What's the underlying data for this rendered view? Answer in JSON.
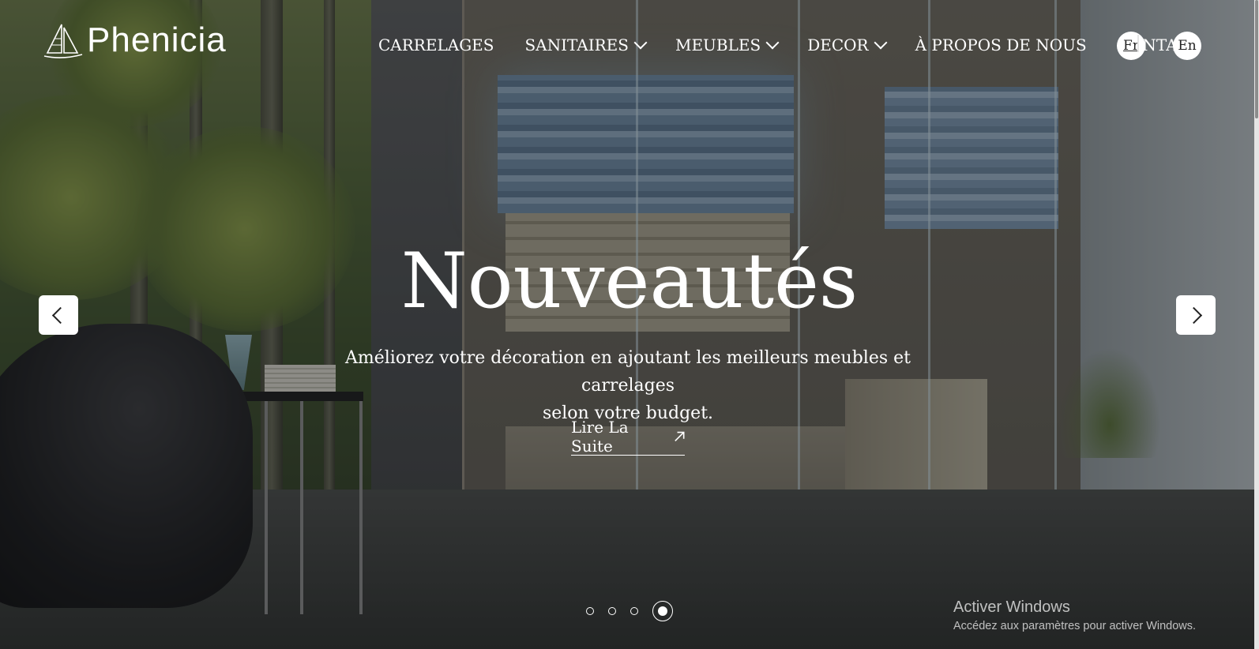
{
  "brand": {
    "name": "Phenicia"
  },
  "nav": {
    "items": [
      {
        "label": "CARRELAGES",
        "dropdown": false
      },
      {
        "label": "SANITAIRES",
        "dropdown": true
      },
      {
        "label": "MEUBLES",
        "dropdown": true
      },
      {
        "label": "DECOR",
        "dropdown": true
      },
      {
        "label": "À PROPOS DE NOUS",
        "dropdown": false
      },
      {
        "label": "CONTACT",
        "dropdown": false
      }
    ],
    "languages": {
      "fr": "Fr",
      "en": "En",
      "selected": "Fr"
    }
  },
  "hero": {
    "title": "Nouveautés",
    "subtitle_line1": "Améliorez votre décoration en ajoutant les meilleurs meubles et carrelages",
    "subtitle_line2": "selon votre budget.",
    "cta_label": "Lire La Suite",
    "cta_icon": "arrow-up-right-icon",
    "prev_icon": "chevron-left-icon",
    "next_icon": "chevron-right-icon",
    "slides_count": 4,
    "active_slide": 4
  },
  "system_watermark": {
    "title": "Activer Windows",
    "subtitle": "Accédez aux paramètres pour activer Windows."
  },
  "colors": {
    "text": "#ffffff",
    "button_bg": "#ffffff",
    "icon_dark": "#222222"
  }
}
